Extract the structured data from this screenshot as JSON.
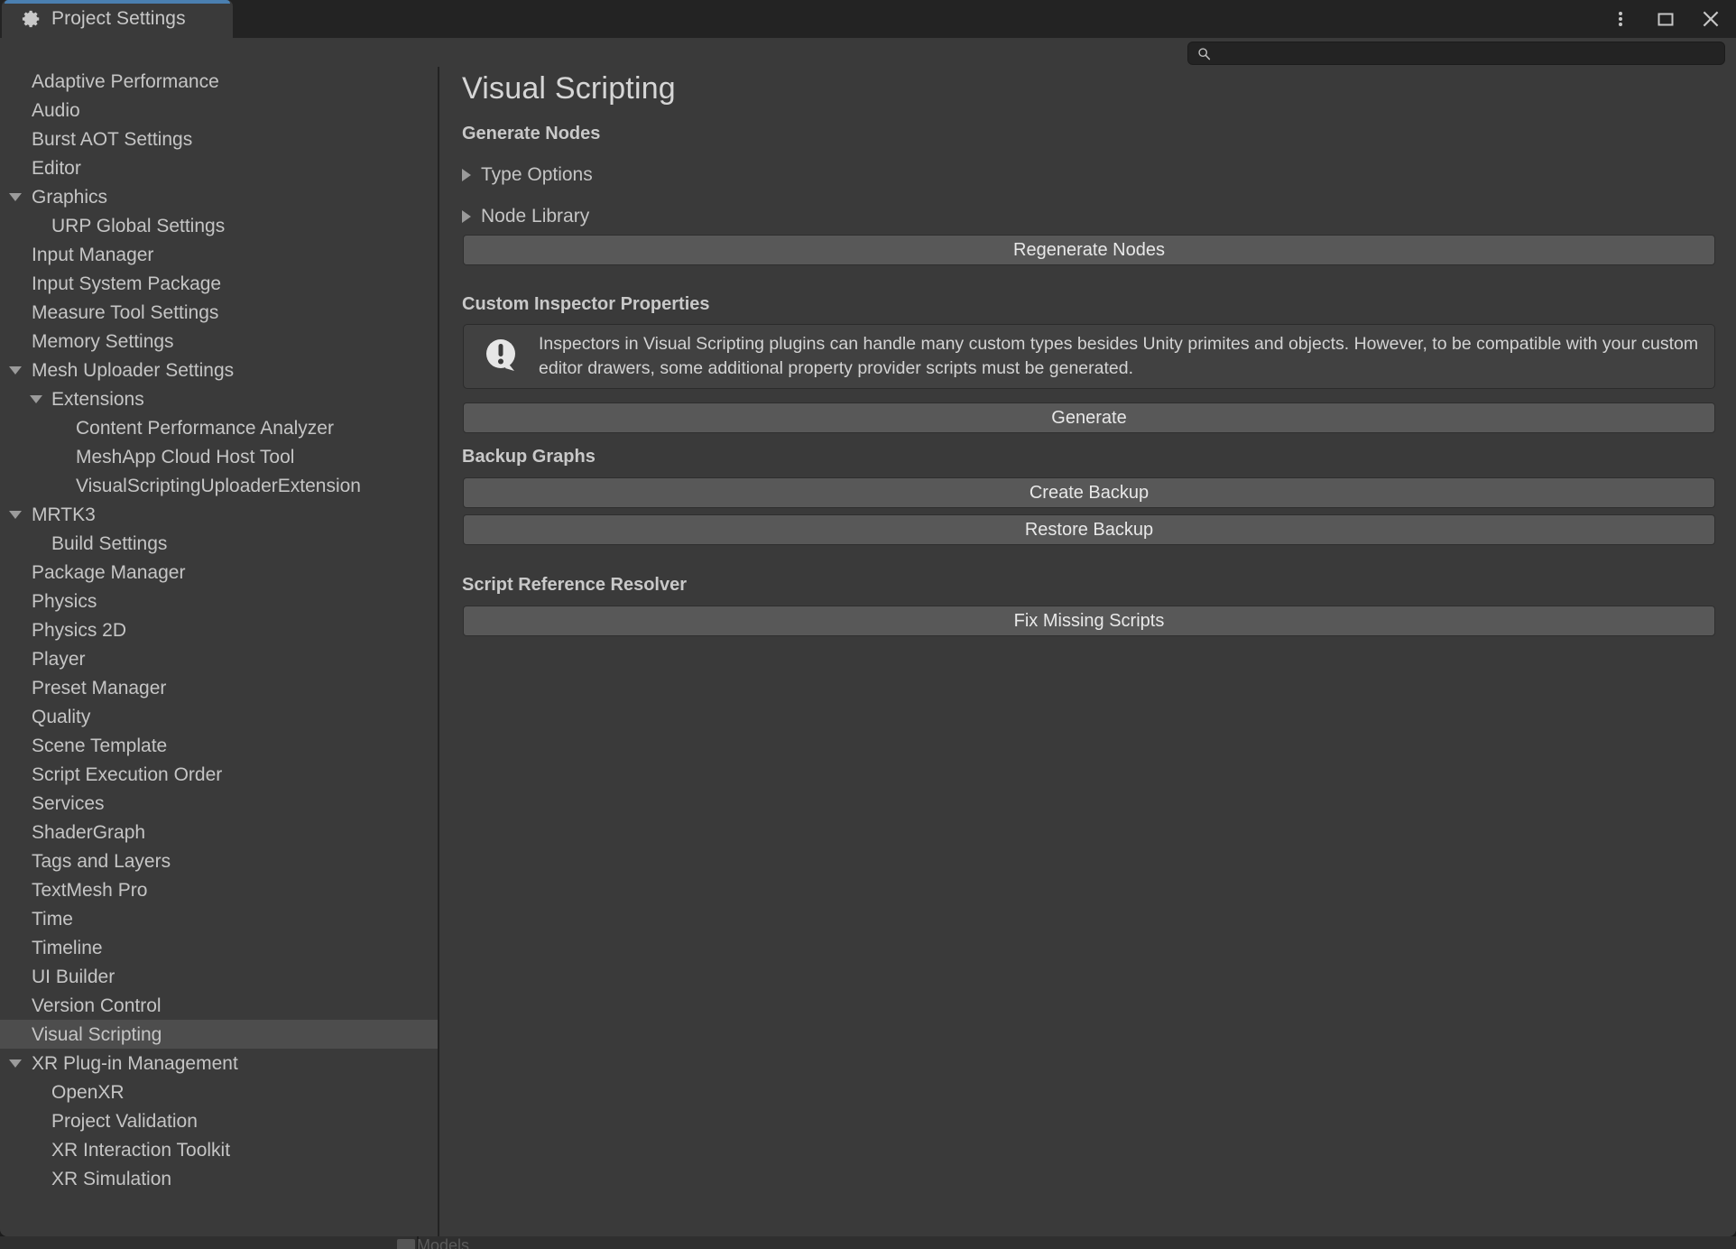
{
  "window": {
    "tab_label": "Project Settings",
    "tab_icon": "gear-icon",
    "controls": {
      "menu_icon": "kebab-menu-icon",
      "maximize_icon": "maximize-icon",
      "close_icon": "close-icon"
    }
  },
  "search": {
    "icon": "search-icon",
    "value": "",
    "placeholder": ""
  },
  "sidebar": {
    "items": [
      {
        "label": "Adaptive Performance",
        "level": 0,
        "arrow": "none",
        "selected": false
      },
      {
        "label": "Audio",
        "level": 0,
        "arrow": "none",
        "selected": false
      },
      {
        "label": "Burst AOT Settings",
        "level": 0,
        "arrow": "none",
        "selected": false
      },
      {
        "label": "Editor",
        "level": 0,
        "arrow": "none",
        "selected": false
      },
      {
        "label": "Graphics",
        "level": 0,
        "arrow": "open",
        "selected": false
      },
      {
        "label": "URP Global Settings",
        "level": 1,
        "arrow": "none",
        "selected": false
      },
      {
        "label": "Input Manager",
        "level": 0,
        "arrow": "none",
        "selected": false
      },
      {
        "label": "Input System Package",
        "level": 0,
        "arrow": "none",
        "selected": false
      },
      {
        "label": "Measure Tool Settings",
        "level": 0,
        "arrow": "none",
        "selected": false
      },
      {
        "label": "Memory Settings",
        "level": 0,
        "arrow": "none",
        "selected": false
      },
      {
        "label": "Mesh Uploader Settings",
        "level": 0,
        "arrow": "open",
        "selected": false
      },
      {
        "label": "Extensions",
        "level": 1,
        "arrow": "open",
        "selected": false
      },
      {
        "label": "Content Performance Analyzer",
        "level": 2,
        "arrow": "none",
        "selected": false
      },
      {
        "label": "MeshApp Cloud Host Tool",
        "level": 2,
        "arrow": "none",
        "selected": false
      },
      {
        "label": "VisualScriptingUploaderExtension",
        "level": 2,
        "arrow": "none",
        "selected": false
      },
      {
        "label": "MRTK3",
        "level": 0,
        "arrow": "open",
        "selected": false
      },
      {
        "label": "Build Settings",
        "level": 1,
        "arrow": "none",
        "selected": false
      },
      {
        "label": "Package Manager",
        "level": 0,
        "arrow": "none",
        "selected": false
      },
      {
        "label": "Physics",
        "level": 0,
        "arrow": "none",
        "selected": false
      },
      {
        "label": "Physics 2D",
        "level": 0,
        "arrow": "none",
        "selected": false
      },
      {
        "label": "Player",
        "level": 0,
        "arrow": "none",
        "selected": false
      },
      {
        "label": "Preset Manager",
        "level": 0,
        "arrow": "none",
        "selected": false
      },
      {
        "label": "Quality",
        "level": 0,
        "arrow": "none",
        "selected": false
      },
      {
        "label": "Scene Template",
        "level": 0,
        "arrow": "none",
        "selected": false
      },
      {
        "label": "Script Execution Order",
        "level": 0,
        "arrow": "none",
        "selected": false
      },
      {
        "label": "Services",
        "level": 0,
        "arrow": "none",
        "selected": false
      },
      {
        "label": "ShaderGraph",
        "level": 0,
        "arrow": "none",
        "selected": false
      },
      {
        "label": "Tags and Layers",
        "level": 0,
        "arrow": "none",
        "selected": false
      },
      {
        "label": "TextMesh Pro",
        "level": 0,
        "arrow": "none",
        "selected": false
      },
      {
        "label": "Time",
        "level": 0,
        "arrow": "none",
        "selected": false
      },
      {
        "label": "Timeline",
        "level": 0,
        "arrow": "none",
        "selected": false
      },
      {
        "label": "UI Builder",
        "level": 0,
        "arrow": "none",
        "selected": false
      },
      {
        "label": "Version Control",
        "level": 0,
        "arrow": "none",
        "selected": false
      },
      {
        "label": "Visual Scripting",
        "level": 0,
        "arrow": "none",
        "selected": true
      },
      {
        "label": "XR Plug-in Management",
        "level": 0,
        "arrow": "open",
        "selected": false
      },
      {
        "label": "OpenXR",
        "level": 1,
        "arrow": "none",
        "selected": false
      },
      {
        "label": "Project Validation",
        "level": 1,
        "arrow": "none",
        "selected": false
      },
      {
        "label": "XR Interaction Toolkit",
        "level": 1,
        "arrow": "none",
        "selected": false
      },
      {
        "label": "XR Simulation",
        "level": 1,
        "arrow": "none",
        "selected": false
      }
    ]
  },
  "main": {
    "title": "Visual Scripting",
    "sections": {
      "generate_nodes": {
        "heading": "Generate Nodes",
        "foldouts": [
          {
            "label": "Type Options",
            "expanded": false
          },
          {
            "label": "Node Library",
            "expanded": false
          }
        ],
        "button": "Regenerate Nodes"
      },
      "custom_inspector": {
        "heading": "Custom Inspector Properties",
        "help_icon": "info-bubble-icon",
        "help_text": "Inspectors in Visual Scripting plugins can handle many custom types besides Unity primites and objects. However, to be compatible with your custom editor drawers, some additional property provider scripts must be generated.",
        "button": "Generate"
      },
      "backup_graphs": {
        "heading": "Backup Graphs",
        "create_button": "Create Backup",
        "restore_button": "Restore Backup"
      },
      "script_reference_resolver": {
        "heading": "Script Reference Resolver",
        "button": "Fix Missing Scripts"
      }
    }
  },
  "background_peek": {
    "label": "Models"
  },
  "colors": {
    "window_bg": "#3a3a3a",
    "titlebar_bg": "#232323",
    "tab_accent": "#4a7fb0",
    "button_bg": "#585858",
    "selected_row": "#4d4d4d",
    "text_primary": "#c5c5c5",
    "title_text": "#d6d6d6"
  }
}
